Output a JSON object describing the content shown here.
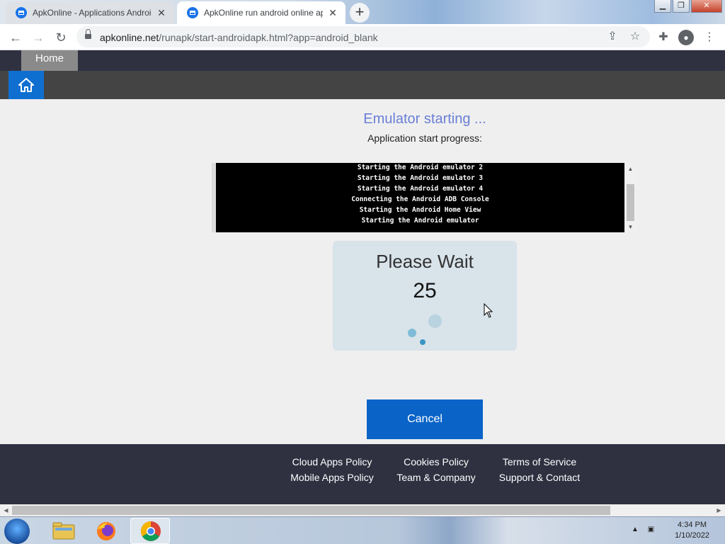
{
  "browser": {
    "tabs": [
      {
        "title": "ApkOnline - Applications Android",
        "active": false
      },
      {
        "title": "ApkOnline run android online ap",
        "active": true
      }
    ],
    "new_tab_label": "+",
    "url_host": "apkonline.net",
    "url_path": "/runapk/start-androidapk.html?app=android_blank"
  },
  "site_nav": {
    "home_label": "Home"
  },
  "status": {
    "title": "Emulator starting ...",
    "subtitle": "Application start progress:"
  },
  "console": {
    "lines": [
      "Starting the Android emulator 2",
      "Starting the Android emulator 3",
      "Starting the Android emulator 4",
      "Connecting the Android ADB Console",
      "Starting the Android Home View",
      "Starting the Android emulator"
    ]
  },
  "wait": {
    "title": "Please Wait",
    "countdown": "25"
  },
  "cancel_label": "Cancel",
  "footer": {
    "links": [
      "Cloud Apps Policy",
      "Cookies Policy",
      "Terms of Service",
      "Mobile Apps Policy",
      "Team & Company",
      "Support & Contact"
    ]
  },
  "taskbar": {
    "time": "4:34 PM",
    "date": "1/10/2022"
  },
  "colors": {
    "accent_blue": "#0a64c8",
    "status_title": "#6a7fd6",
    "nav_dark": "#2f3141"
  }
}
